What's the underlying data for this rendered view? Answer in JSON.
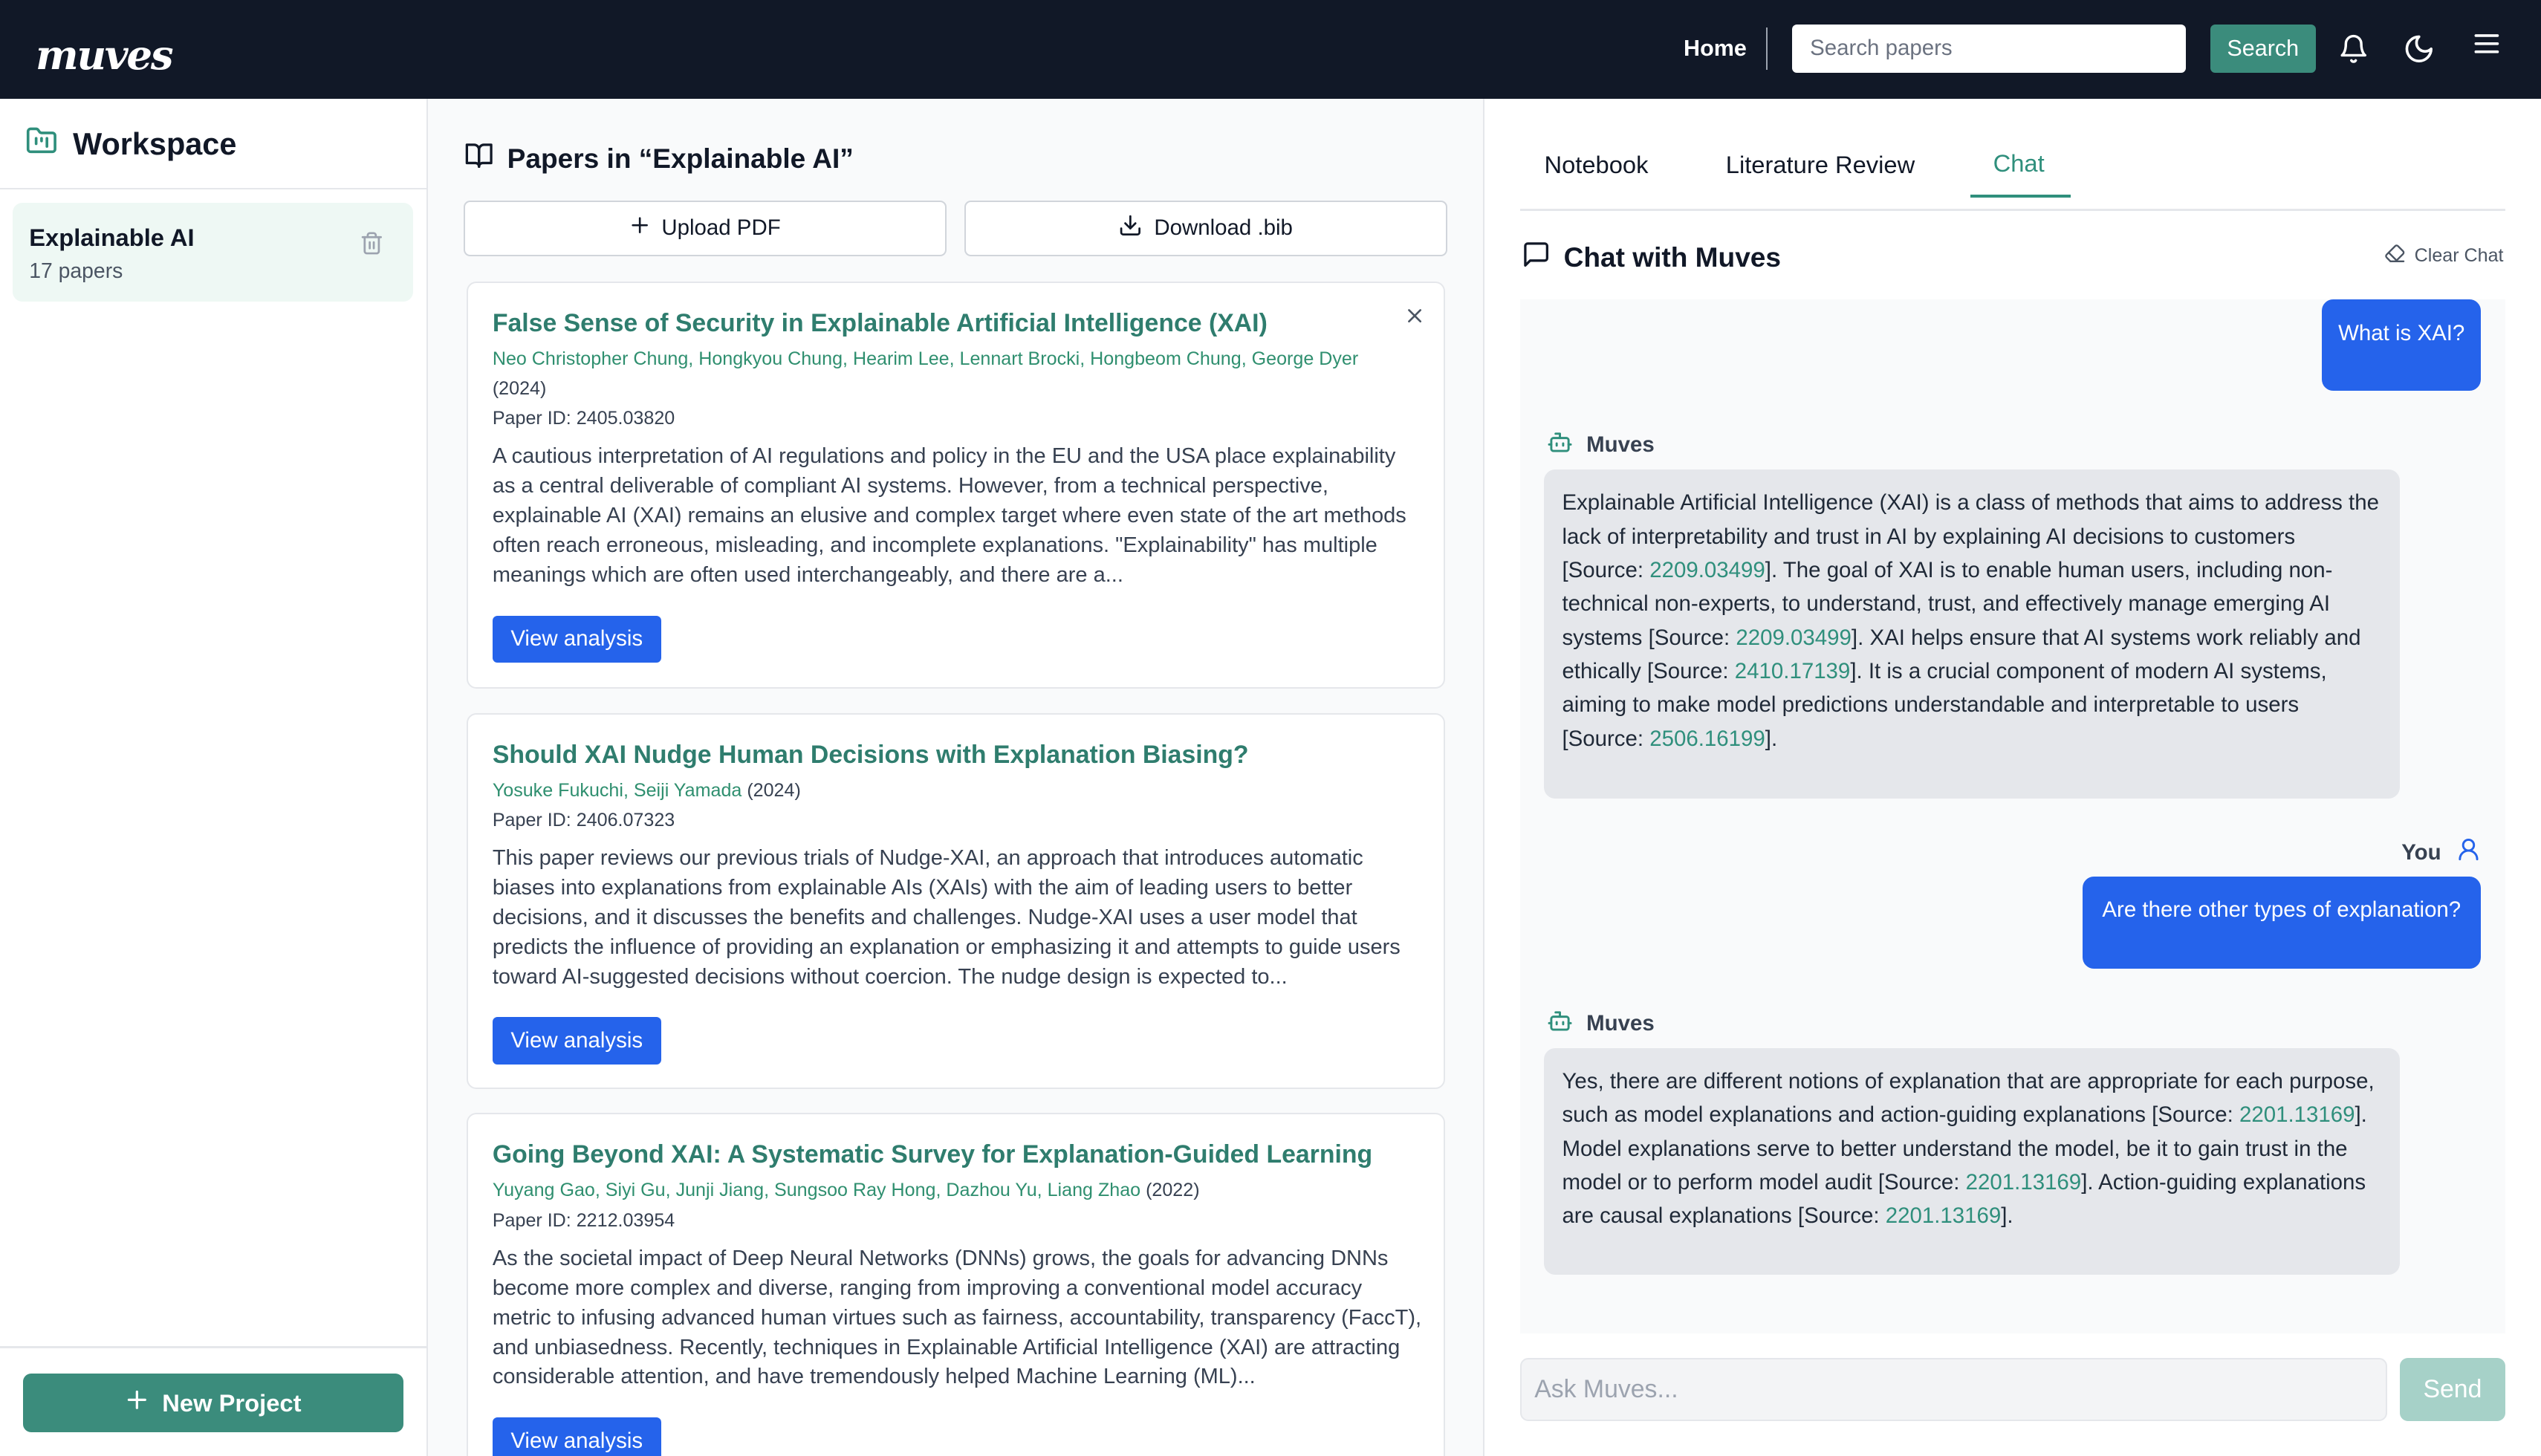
{
  "header": {
    "logo": "muves",
    "home": "Home",
    "search_placeholder": "Search papers",
    "search_button": "Search"
  },
  "workspace": {
    "title": "Workspace",
    "projects": [
      {
        "name": "Explainable AI",
        "count": "17 papers"
      }
    ],
    "new_project": "New Project"
  },
  "papers": {
    "heading": "Papers in “Explainable AI”",
    "upload": "Upload PDF",
    "download": "Download .bib",
    "view_label": "View analysis",
    "items": [
      {
        "title": "False Sense of Security in Explainable Artificial Intelligence (XAI)",
        "authors": "Neo Christopher Chung, Hongkyou Chung, Hearim Lee, Lennart Brocki, Hongbeom Chung, George Dyer",
        "year": "(2024)",
        "paper_id": "Paper ID: 2405.03820",
        "abstract": "A cautious interpretation of AI regulations and policy in the EU and the USA place explainability as a central deliverable of compliant AI systems. However, from a technical perspective, explainable AI (XAI) remains an elusive and complex target where even state of the art methods often reach erroneous, misleading, and incomplete explanations. \"Explainability\" has multiple meanings which are often used interchangeably, and there are a..."
      },
      {
        "title": "Should XAI Nudge Human Decisions with Explanation Biasing?",
        "authors": "Yosuke Fukuchi, Seiji Yamada",
        "year": "(2024)",
        "paper_id": "Paper ID: 2406.07323",
        "abstract": "This paper reviews our previous trials of Nudge-XAI, an approach that introduces automatic biases into explanations from explainable AIs (XAIs) with the aim of leading users to better decisions, and it discusses the benefits and challenges. Nudge-XAI uses a user model that predicts the influence of providing an explanation or emphasizing it and attempts to guide users toward AI-suggested decisions without coercion. The nudge design is expected to..."
      },
      {
        "title": "Going Beyond XAI: A Systematic Survey for Explanation-Guided Learning",
        "authors": "Yuyang Gao, Siyi Gu, Junji Jiang, Sungsoo Ray Hong, Dazhou Yu, Liang Zhao",
        "year": "(2022)",
        "paper_id": "Paper ID: 2212.03954",
        "abstract": "As the societal impact of Deep Neural Networks (DNNs) grows, the goals for advancing DNNs become more complex and diverse, ranging from improving a conventional model accuracy metric to infusing advanced human virtues such as fairness, accountability, transparency (FaccT), and unbiasedness. Recently, techniques in Explainable Artificial Intelligence (XAI) are attracting considerable attention, and have tremendously helped Machine Learning (ML)..."
      }
    ]
  },
  "tabs": [
    "Notebook",
    "Literature Review",
    "Chat"
  ],
  "chat": {
    "title": "Chat with Muves",
    "clear": "Clear Chat",
    "bot_name": "Muves",
    "user_name": "You",
    "user_msg_1": "What is XAI?",
    "bot_msg_1": [
      {
        "t": "Explainable Artificial Intelligence (XAI) is a class of methods that aims to address the lack of interpretability and trust in AI by explaining AI decisions to customers [Source: "
      },
      {
        "s": "2209.03499"
      },
      {
        "t": "]. The goal of XAI is to enable human users, including non-technical non-experts, to understand, trust, and effectively manage emerging AI systems [Source: "
      },
      {
        "s": "2209.03499"
      },
      {
        "t": "]. XAI helps ensure that AI systems work reliably and ethically [Source: "
      },
      {
        "s": "2410.17139"
      },
      {
        "t": "]. It is a crucial component of modern AI systems, aiming to make model predictions understandable and interpretable to users [Source: "
      },
      {
        "s": "2506.16199"
      },
      {
        "t": "]."
      }
    ],
    "user_msg_2": "Are there other types of explanation?",
    "bot_msg_2": [
      {
        "t": "Yes, there are different notions of explanation that are appropriate for each purpose, such as model explanations and action-guiding explanations [Source: "
      },
      {
        "s": "2201.13169"
      },
      {
        "t": "]. Model explanations serve to better understand the model, be it to gain trust in the model or to perform model audit [Source: "
      },
      {
        "s": "2201.13169"
      },
      {
        "t": "]. Action-guiding explanations are causal explanations [Source: "
      },
      {
        "s": "2201.13169"
      },
      {
        "t": "]."
      }
    ],
    "input_placeholder": "Ask Muves...",
    "send": "Send"
  },
  "colors": {
    "brand": "#3b8c7c",
    "link": "#2f8f7c",
    "primary": "#2563eb",
    "topbar": "#111827"
  }
}
